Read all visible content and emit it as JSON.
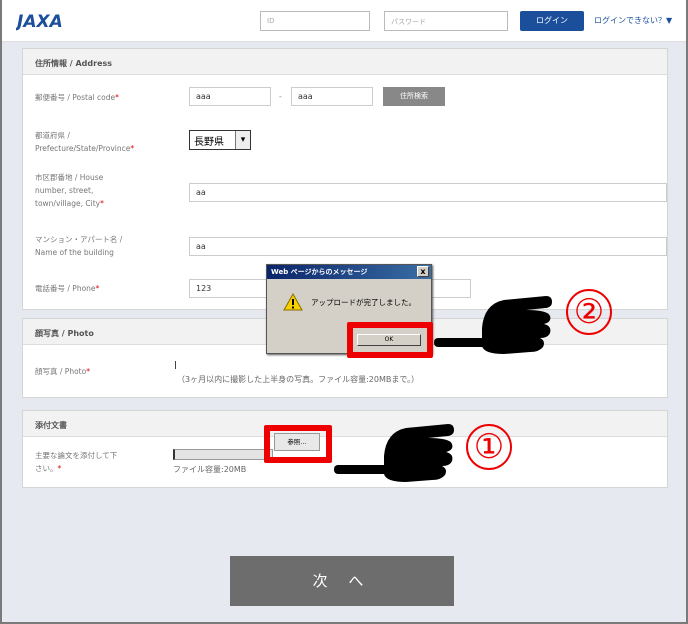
{
  "header": {
    "id_placeholder": "ID",
    "pw_placeholder": "パスワード",
    "login_label": "ログイン",
    "cant_login_label": "ログインできない？▼"
  },
  "address": {
    "section_title": "住所情報 / Address",
    "postal_label": "郵便番号 / Postal code",
    "postal_value_1": "aaa",
    "postal_dash": "-",
    "postal_value_2": "aaa",
    "postal_search_label": "住所検索",
    "pref_label_1": "都道府県 /",
    "pref_label_2": "Prefecture/State/Province",
    "pref_value": "長野県",
    "city_label_1": "市区郡番地 / House",
    "city_label_2": "number,  street,",
    "city_label_3": "town/village,  City",
    "city_value": "aa",
    "building_label_1": "マンション・アパート名 /",
    "building_label_2": "Name of the building",
    "building_value": "aa",
    "phone_label": "電話番号 / Phone",
    "phone_value": "123",
    "required_mark": "*"
  },
  "photo": {
    "section_title": "顔写真 / Photo",
    "field_label": "顔写真 / Photo",
    "note": "（3ヶ月以内に撮影した上半身の写真。ファイル容量:20MBまで。）"
  },
  "attachment": {
    "section_title": "添付文書",
    "field_label_1": "主要な論文を添付して下",
    "field_label_2": "さい。",
    "browse_label": "参照...",
    "size_note": "ファイル容量:20MB"
  },
  "next_button_label": "次 へ",
  "dialog": {
    "title": "Web ページからのメッセージ",
    "close_label": "x",
    "message": "アップロードが完了しました。",
    "ok_label": "OK"
  },
  "callouts": {
    "step1": "①",
    "step2": "②"
  },
  "colors": {
    "highlight": "#ee0000",
    "login_button": "#1b4e9b",
    "next_button": "#6d6d6d"
  }
}
